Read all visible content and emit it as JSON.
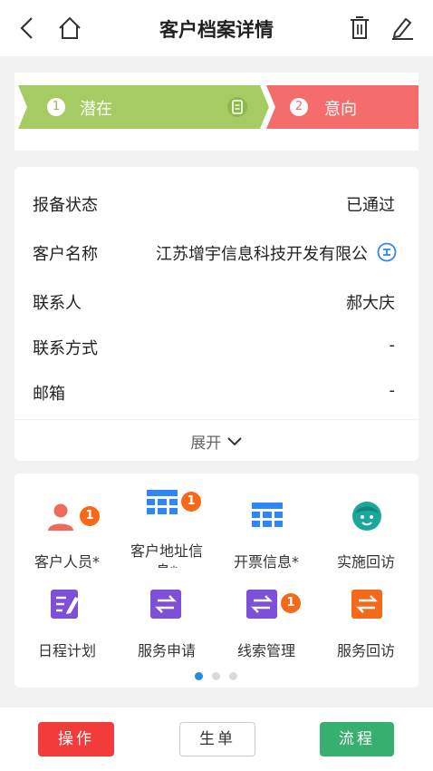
{
  "header": {
    "title": "客户档案详情",
    "back_icon": "chevron-left-icon",
    "home_icon": "home-icon",
    "delete_icon": "trash-icon",
    "edit_icon": "edit-pencil-icon"
  },
  "stages": [
    {
      "num": "1",
      "label": "潜在",
      "color": "#a5cc62",
      "current": true
    },
    {
      "num": "2",
      "label": "意向",
      "color": "#f56c6c",
      "current": false
    }
  ],
  "info": {
    "rows": [
      {
        "label": "报备状态",
        "value": "已通过"
      },
      {
        "label": "客户名称",
        "value": "江苏增宇信息科技开发有限公"
      },
      {
        "label": "联系人",
        "value": "郝大庆"
      },
      {
        "label": "联系方式",
        "value": "-"
      },
      {
        "label": "邮箱",
        "value": "-"
      }
    ],
    "expand_label": "展开"
  },
  "grid": {
    "items": [
      {
        "label": "客户人员*",
        "icon": "person-icon",
        "color": "#f06a5a",
        "badge": "1"
      },
      {
        "label": "客户地址信息*",
        "label_line1": "客户地址信",
        "label_line2": "息*",
        "icon": "grid-table-icon",
        "color": "#2f86f6",
        "badge": "1"
      },
      {
        "label": "开票信息*",
        "icon": "grid-table-icon",
        "color": "#2f86f6",
        "badge": ""
      },
      {
        "label": "实施回访",
        "icon": "face-icon",
        "color": "#1aa89c",
        "badge": ""
      },
      {
        "label": "日程计划",
        "icon": "edit-list-icon",
        "color": "#7e4fd8",
        "badge": ""
      },
      {
        "label": "服务申请",
        "icon": "exchange-icon",
        "color": "#7e4fd8",
        "badge": ""
      },
      {
        "label": "线索管理",
        "icon": "exchange-icon",
        "color": "#7e4fd8",
        "badge": "1"
      },
      {
        "label": "服务回访",
        "icon": "exchange-icon",
        "color": "#f56a1a",
        "badge": ""
      }
    ],
    "page_count": 3,
    "current_page": 1
  },
  "footer": {
    "operate": "操作",
    "generate": "生单",
    "process": "流程"
  },
  "colors": {
    "operate": "#f23b3b",
    "process": "#37b06f",
    "dot_active": "#1a8fe3"
  }
}
